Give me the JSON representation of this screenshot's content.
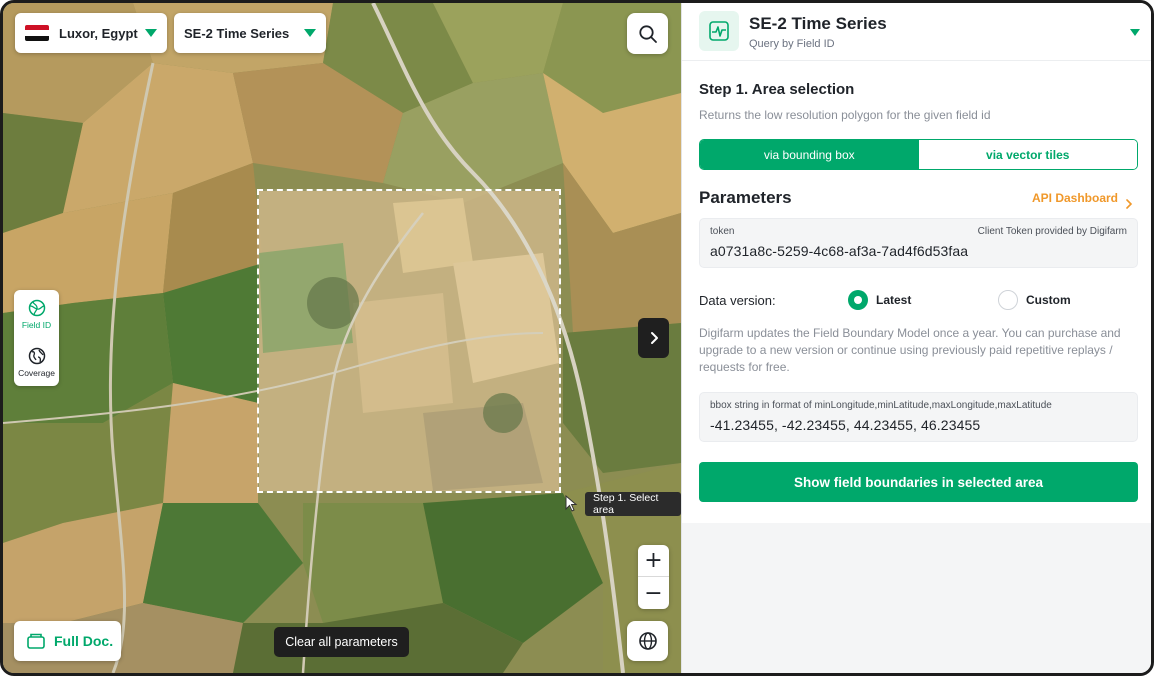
{
  "map": {
    "location_select": {
      "value": "Luxor, Egypt",
      "flag": "egypt-flag"
    },
    "dataset_select": {
      "value": "SE-2 Time Series"
    },
    "tools": [
      {
        "label": "Field ID",
        "icon": "field-id-icon",
        "active": true
      },
      {
        "label": "Coverage",
        "icon": "coverage-icon",
        "active": false
      }
    ],
    "tooltip": "Step 1. Select area",
    "zoom_in": "+",
    "zoom_out": "−",
    "full_doc_label": "Full Doc.",
    "clear_label": "Clear all parameters"
  },
  "panel": {
    "title": "SE-2 Time Series",
    "subtitle": "Query by Field ID",
    "step_title": "Step 1. Area selection",
    "step_desc": "Returns the low resolution polygon for the given field id",
    "modes": [
      "via bounding box",
      "via vector tiles"
    ],
    "params_title": "Parameters",
    "api_link": "API Dashboard",
    "token": {
      "label": "token",
      "hint": "Client Token provided by Digifarm",
      "value": "a0731a8c-5259-4c68-af3a-7ad4f6d53faa"
    },
    "data_version": {
      "label": "Data version:",
      "options": [
        "Latest",
        "Custom"
      ],
      "selected": "Latest"
    },
    "data_version_desc": "Digifarm updates the Field Boundary Model once a year. You can purchase and upgrade to a new version or continue using previously paid repetitive replays / requests for free.",
    "bbox": {
      "label": "bbox string in format of minLongitude,minLatitude,maxLongitude,maxLatitude",
      "value": "-41.23455, -42.23455, 44.23455, 46.23455"
    },
    "submit_label": "Show field boundaries in selected area"
  },
  "colors": {
    "accent": "#00a86b",
    "link": "#f0982a",
    "dark_button": "#1f1f1f"
  }
}
